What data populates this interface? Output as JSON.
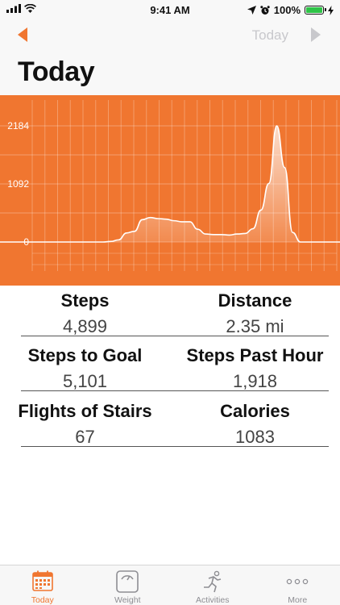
{
  "status": {
    "time": "9:41 AM",
    "battery": "100%"
  },
  "nav": {
    "date": "Today"
  },
  "page": {
    "title": "Today"
  },
  "chart_data": {
    "type": "area",
    "y_ticks": [
      "2184",
      "1092",
      "0"
    ],
    "ylim": [
      0,
      2184
    ],
    "x": [
      0,
      4,
      8,
      12,
      16,
      20,
      24,
      28,
      32,
      36,
      40,
      44,
      48,
      52,
      56,
      60,
      64,
      68,
      72,
      76,
      80,
      84,
      88,
      92,
      96,
      100
    ],
    "values": [
      0,
      0,
      0,
      0,
      0,
      0,
      0,
      0,
      0,
      0,
      0,
      0,
      0,
      0,
      10,
      40,
      170,
      200,
      420,
      460,
      440,
      430,
      400,
      380,
      380,
      240,
      150,
      140,
      140,
      130,
      150,
      160,
      250,
      600,
      1100,
      2184,
      1400,
      180,
      0,
      0,
      0,
      0,
      0,
      0
    ],
    "grid": true,
    "colors": {
      "background": "#f07630",
      "fill": "#ffffff"
    }
  },
  "stats": [
    {
      "label": "Steps",
      "value": "4,899"
    },
    {
      "label": "Distance",
      "value": "2.35 mi"
    },
    {
      "label": "Steps to Goal",
      "value": "5,101"
    },
    {
      "label": "Steps Past Hour",
      "value": "1,918"
    },
    {
      "label": "Flights of Stairs",
      "value": "67"
    },
    {
      "label": "Calories",
      "value": "1083"
    }
  ],
  "tabs": [
    {
      "label": "Today",
      "icon": "calendar-icon",
      "active": true
    },
    {
      "label": "Weight",
      "icon": "scale-icon",
      "active": false
    },
    {
      "label": "Activities",
      "icon": "runner-icon",
      "active": false
    },
    {
      "label": "More",
      "icon": "more-icon",
      "active": false
    }
  ],
  "colors": {
    "accent": "#f07630"
  }
}
